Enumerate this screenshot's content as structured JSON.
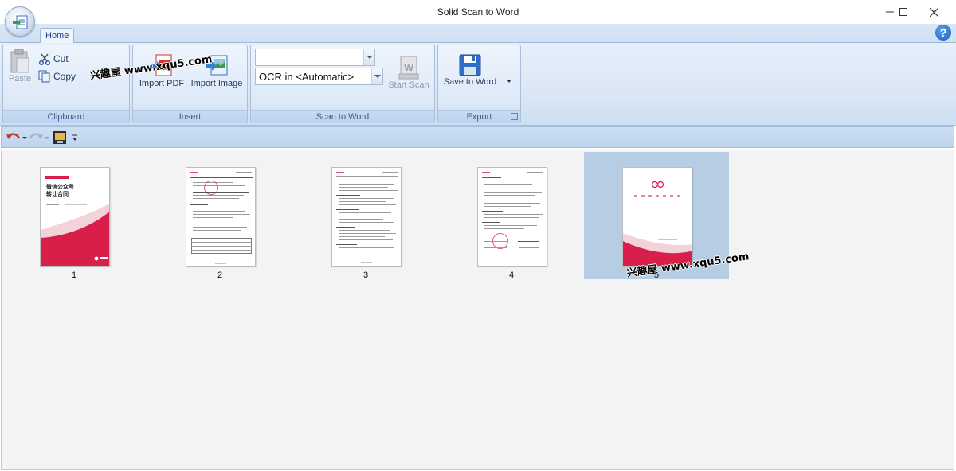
{
  "window": {
    "title": "Solid Scan to Word"
  },
  "ribbon": {
    "tabs": [
      {
        "label": "Home"
      }
    ],
    "groups": {
      "clipboard": {
        "label": "Clipboard",
        "paste": "Paste",
        "cut": "Cut",
        "copy": "Copy"
      },
      "insert": {
        "label": "Insert",
        "import_pdf": "Import PDF",
        "import_image": "Import Image"
      },
      "scan": {
        "label": "Scan to Word",
        "combo_top_value": "",
        "ocr_value": "OCR in <Automatic>",
        "start_scan": "Start Scan"
      },
      "export": {
        "label": "Export",
        "save_to_word": "Save to Word"
      }
    }
  },
  "watermark": "兴趣屋 www.xqu5.com",
  "pages": [
    {
      "number": "1",
      "title_lines": [
        "微信公众号",
        "转让合同"
      ]
    },
    {
      "number": "2"
    },
    {
      "number": "3"
    },
    {
      "number": "4"
    },
    {
      "number": "5"
    }
  ],
  "colors": {
    "accent": "#d81f4a",
    "selection": "#b6cde3",
    "ribbon": "#dbe7f6"
  }
}
